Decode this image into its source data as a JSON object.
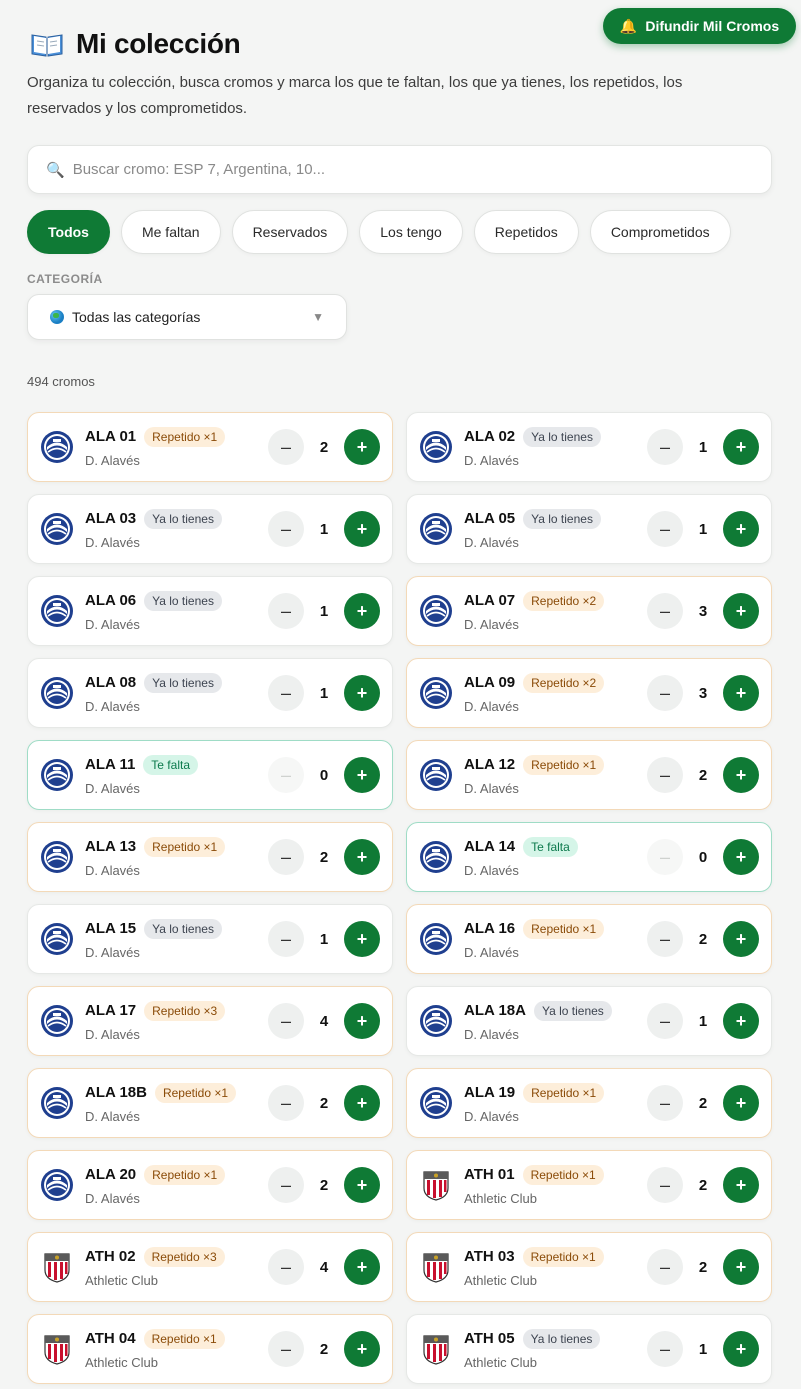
{
  "header": {
    "share_label": "Difundir Mil Cromos",
    "title": "Mi colección",
    "subtitle": "Organiza tu colección, busca cromos y marca los que te faltan, los que ya tienes, los repetidos, los reservados y los comprometidos."
  },
  "search": {
    "placeholder": "Buscar cromo: ESP 7, Argentina, 10..."
  },
  "filters": [
    "Todos",
    "Me faltan",
    "Reservados",
    "Los tengo",
    "Repetidos",
    "Comprometidos"
  ],
  "active_filter": "Todos",
  "category": {
    "label": "CATEGORÍA",
    "selected": "Todas las categorías"
  },
  "count_label": "494 cromos",
  "colors": {
    "primary": "#0f7a35",
    "alaves_blue": "#1f3f8f",
    "athletic_red": "#c8102e"
  },
  "cards": [
    {
      "code": "ALA 01",
      "team": "D. Alavés",
      "crest": "alaves",
      "status": "rep",
      "badge": "Repetido ×1",
      "qty": "2"
    },
    {
      "code": "ALA 02",
      "team": "D. Alavés",
      "crest": "alaves",
      "status": "have",
      "badge": "Ya lo tienes",
      "qty": "1"
    },
    {
      "code": "ALA 03",
      "team": "D. Alavés",
      "crest": "alaves",
      "status": "have",
      "badge": "Ya lo tienes",
      "qty": "1"
    },
    {
      "code": "ALA 05",
      "team": "D. Alavés",
      "crest": "alaves",
      "status": "have",
      "badge": "Ya lo tienes",
      "qty": "1"
    },
    {
      "code": "ALA 06",
      "team": "D. Alavés",
      "crest": "alaves",
      "status": "have",
      "badge": "Ya lo tienes",
      "qty": "1"
    },
    {
      "code": "ALA 07",
      "team": "D. Alavés",
      "crest": "alaves",
      "status": "rep",
      "badge": "Repetido ×2",
      "qty": "3"
    },
    {
      "code": "ALA 08",
      "team": "D. Alavés",
      "crest": "alaves",
      "status": "have",
      "badge": "Ya lo tienes",
      "qty": "1"
    },
    {
      "code": "ALA 09",
      "team": "D. Alavés",
      "crest": "alaves",
      "status": "rep",
      "badge": "Repetido ×2",
      "qty": "3"
    },
    {
      "code": "ALA 11",
      "team": "D. Alavés",
      "crest": "alaves",
      "status": "miss",
      "badge": "Te falta",
      "qty": "0"
    },
    {
      "code": "ALA 12",
      "team": "D. Alavés",
      "crest": "alaves",
      "status": "rep",
      "badge": "Repetido ×1",
      "qty": "2"
    },
    {
      "code": "ALA 13",
      "team": "D. Alavés",
      "crest": "alaves",
      "status": "rep",
      "badge": "Repetido ×1",
      "qty": "2"
    },
    {
      "code": "ALA 14",
      "team": "D. Alavés",
      "crest": "alaves",
      "status": "miss",
      "badge": "Te falta",
      "qty": "0"
    },
    {
      "code": "ALA 15",
      "team": "D. Alavés",
      "crest": "alaves",
      "status": "have",
      "badge": "Ya lo tienes",
      "qty": "1"
    },
    {
      "code": "ALA 16",
      "team": "D. Alavés",
      "crest": "alaves",
      "status": "rep",
      "badge": "Repetido ×1",
      "qty": "2"
    },
    {
      "code": "ALA 17",
      "team": "D. Alavés",
      "crest": "alaves",
      "status": "rep",
      "badge": "Repetido ×3",
      "qty": "4"
    },
    {
      "code": "ALA 18A",
      "team": "D. Alavés",
      "crest": "alaves",
      "status": "have",
      "badge": "Ya lo tienes",
      "qty": "1"
    },
    {
      "code": "ALA 18B",
      "team": "D. Alavés",
      "crest": "alaves",
      "status": "rep",
      "badge": "Repetido ×1",
      "qty": "2"
    },
    {
      "code": "ALA 19",
      "team": "D. Alavés",
      "crest": "alaves",
      "status": "rep",
      "badge": "Repetido ×1",
      "qty": "2"
    },
    {
      "code": "ALA 20",
      "team": "D. Alavés",
      "crest": "alaves",
      "status": "rep",
      "badge": "Repetido ×1",
      "qty": "2"
    },
    {
      "code": "ATH 01",
      "team": "Athletic Club",
      "crest": "athletic",
      "status": "rep",
      "badge": "Repetido ×1",
      "qty": "2"
    },
    {
      "code": "ATH 02",
      "team": "Athletic Club",
      "crest": "athletic",
      "status": "rep",
      "badge": "Repetido ×3",
      "qty": "4"
    },
    {
      "code": "ATH 03",
      "team": "Athletic Club",
      "crest": "athletic",
      "status": "rep",
      "badge": "Repetido ×1",
      "qty": "2"
    },
    {
      "code": "ATH 04",
      "team": "Athletic Club",
      "crest": "athletic",
      "status": "rep",
      "badge": "Repetido ×1",
      "qty": "2"
    },
    {
      "code": "ATH 05",
      "team": "Athletic Club",
      "crest": "athletic",
      "status": "have",
      "badge": "Ya lo tienes",
      "qty": "1"
    }
  ]
}
